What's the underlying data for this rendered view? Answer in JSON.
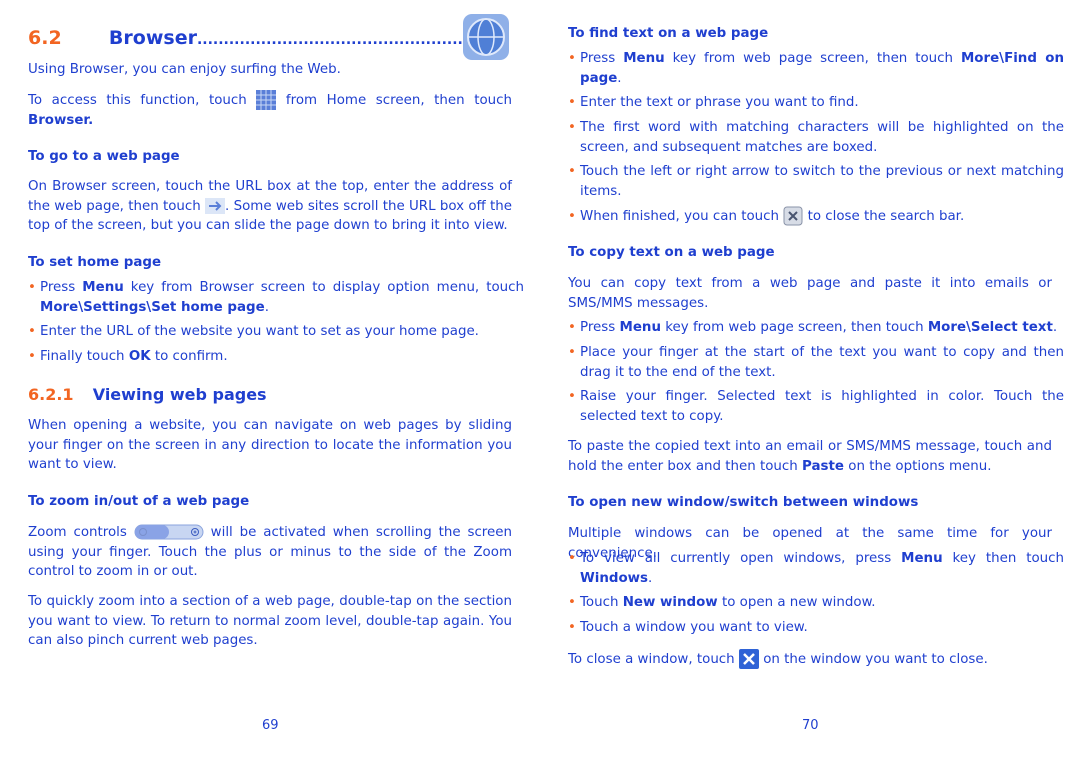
{
  "left": {
    "section_num": "6.2",
    "section_title": "Browser",
    "section_dots": "......................................................",
    "intro": "Using Browser, you can enjoy surfing the Web.",
    "access_a": "To access this function, touch",
    "access_b": "from Home screen, then touch",
    "access_bold": "Browser.",
    "go_heading": "To go to a web page",
    "go_a": "On Browser screen, touch the URL box at the top, enter the address of the web page, then touch",
    "go_b": ". Some web sites scroll the URL box off the top of the screen, but you can slide the page down to bring it into view.",
    "home_heading": "To set home page",
    "home_b1_a": "Press",
    "home_b1_bold": "Menu",
    "home_b1_b": "key from Browser screen to display option menu, touch",
    "home_b1_bold2": "More\\Settings\\Set home page",
    "home_b2": "Enter the URL of the website you want to set as your home page.",
    "home_b3_a": "Finally touch",
    "home_b3_bold": "OK",
    "home_b3_b": "to confirm.",
    "sub_num": "6.2.1",
    "sub_title": "Viewing web pages",
    "view_p": "When opening a website, you can navigate on web pages by sliding your finger on the screen in any direction to locate the information you want to view.",
    "zoom_heading": "To zoom in/out of a web page",
    "zoom_a": "Zoom controls",
    "zoom_b": "will be activated when scrolling the screen using your finger. Touch the plus or minus to the side of the Zoom control to zoom in or out.",
    "zoom_p2": "To quickly zoom into a section of a web page, double-tap on the section you want to view. To return to normal zoom level, double-tap again. You can also pinch current web pages.",
    "page_number": "69"
  },
  "right": {
    "find_heading": "To find text on a web page",
    "find_b1_a": "Press",
    "find_b1_bold": "Menu",
    "find_b1_b": "key from web page screen, then touch",
    "find_b1_bold2": "More\\Find on page",
    "find_b2": "Enter the text or phrase you want to find.",
    "find_b3": "The first word with matching characters will be highlighted on the screen, and subsequent matches are boxed.",
    "find_b4": "Touch the left or right arrow to switch to the previous or next matching items.",
    "find_b5_a": "When finished, you can touch",
    "find_b5_b": "to close the search bar.",
    "copy_heading": "To copy text on a web page",
    "copy_p": "You can copy text from a web page and paste it into emails or SMS/MMS messages.",
    "copy_b1_a": "Press",
    "copy_b1_bold": "Menu",
    "copy_b1_b": "key from web page screen, then touch",
    "copy_b1_bold2": "More\\Select text",
    "copy_b2": "Place your finger at the start of the text you want to copy and then drag it to the end of the text.",
    "copy_b3": "Raise your finger. Selected text is highlighted in color. Touch the selected text to copy.",
    "paste_a": "To paste the copied text into an email or SMS/MMS message, touch and hold the enter box and then touch",
    "paste_bold": "Paste",
    "paste_b": "on the options menu.",
    "win_heading": "To open new window/switch between windows",
    "win_p": "Multiple windows can be opened at the same time for your convenience.",
    "win_b1_a": "To view all currently open windows, press",
    "win_b1_bold": "Menu",
    "win_b1_b": "key then touch",
    "win_b1_bold2": "Windows",
    "win_b2_a": "Touch",
    "win_b2_bold": "New window",
    "win_b2_b": "to open a new window.",
    "win_b3": "Touch a window you want to view.",
    "close_a": "To close a window, touch",
    "close_b": "on the window you want to close.",
    "page_number": "70"
  },
  "colors": {
    "text": "#1f3fcf",
    "accent": "#f26522"
  },
  "icons": [
    "browser-globe-icon",
    "app-grid-icon",
    "go-arrow-icon",
    "zoom-controls-icon",
    "close-search-icon",
    "close-window-icon"
  ]
}
